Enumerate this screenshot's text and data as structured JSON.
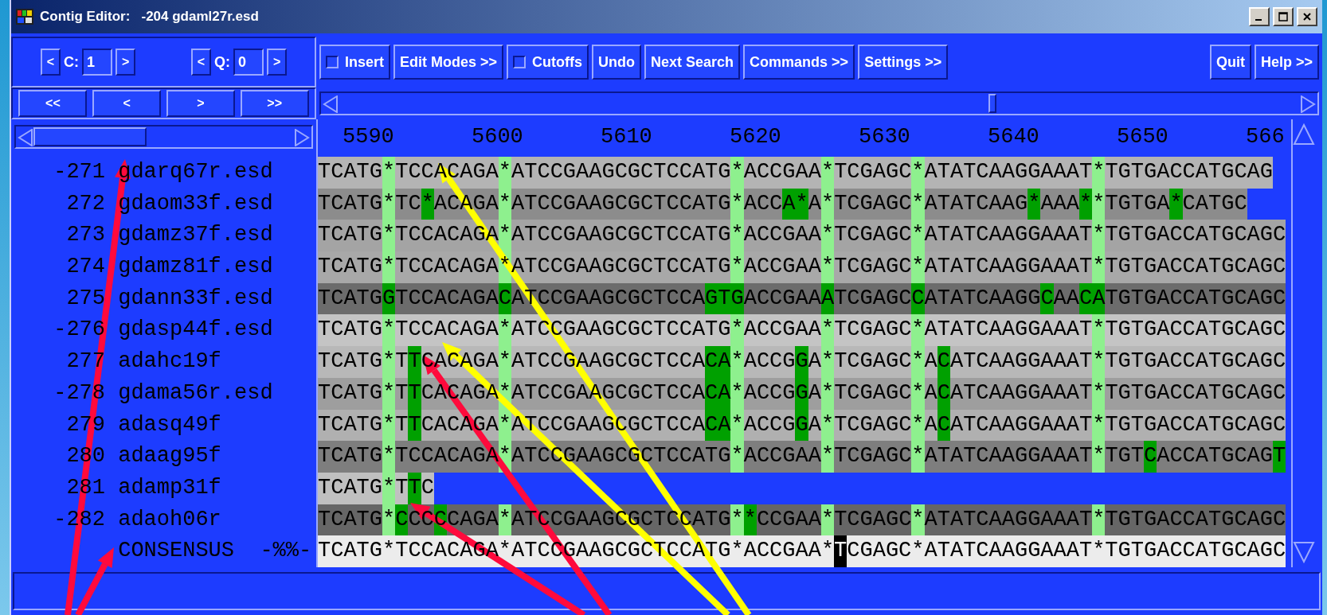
{
  "window": {
    "title": "Contig Editor:   -204 gdaml27r.esd"
  },
  "contig_controls": [
    {
      "label": "C:",
      "value": "1",
      "prev": "<",
      "next": ">"
    },
    {
      "label": "Q:",
      "value": "0",
      "prev": "<",
      "next": ">"
    }
  ],
  "toolbar": [
    {
      "kind": "checkbox",
      "label": "Insert",
      "checked": false
    },
    {
      "kind": "button",
      "label": "Edit Modes >>"
    },
    {
      "kind": "checkbox",
      "label": "Cutoffs",
      "checked": false
    },
    {
      "kind": "button",
      "label": "Undo"
    },
    {
      "kind": "button",
      "label": "Next Search"
    },
    {
      "kind": "button",
      "label": "Commands >>"
    },
    {
      "kind": "button",
      "label": "Settings >>"
    }
  ],
  "toolbar_right": [
    {
      "label": "Quit"
    },
    {
      "label": "Help >>"
    }
  ],
  "nav_buttons": [
    "<<",
    "<",
    ">",
    ">>"
  ],
  "ruler": [
    "5590",
    "5600",
    "5610",
    "5620",
    "5630",
    "5640",
    "5650",
    "566"
  ],
  "readings": [
    {
      "number": "-271",
      "name": "gdarq67r.esd",
      "color": "#b4b4b4",
      "segments": [
        {
          "kind": "base",
          "text": "TCATG"
        },
        {
          "kind": "pad",
          "text": "*"
        },
        {
          "kind": "base",
          "text": "TCCACAGA"
        },
        {
          "kind": "pad",
          "text": "*"
        },
        {
          "kind": "base",
          "text": "ATCCGAAGCGCTCCATG"
        },
        {
          "kind": "pad",
          "text": "*"
        },
        {
          "kind": "base",
          "text": "ACCGAA"
        },
        {
          "kind": "pad",
          "text": "*"
        },
        {
          "kind": "base",
          "text": "TCGAGC"
        },
        {
          "kind": "pad",
          "text": "*"
        },
        {
          "kind": "base",
          "text": "ATATCAAGGAAAT"
        },
        {
          "kind": "pad",
          "text": "*"
        },
        {
          "kind": "base",
          "text": "TGTGACCATGCAG"
        }
      ]
    },
    {
      "number": "272",
      "name": "gdaom33f.esd",
      "color": "#8c8c8c",
      "segments": [
        {
          "kind": "base",
          "text": "TCATG"
        },
        {
          "kind": "pad",
          "text": "*"
        },
        {
          "kind": "base",
          "text": "TC"
        },
        {
          "kind": "diff",
          "text": "*"
        },
        {
          "kind": "base",
          "text": "ACAGA"
        },
        {
          "kind": "pad",
          "text": "*"
        },
        {
          "kind": "base",
          "text": "ATCCGAAGCGCTCCATG"
        },
        {
          "kind": "pad",
          "text": "*"
        },
        {
          "kind": "base",
          "text": "ACC"
        },
        {
          "kind": "diff",
          "text": "A*"
        },
        {
          "kind": "base",
          "text": "A"
        },
        {
          "kind": "pad",
          "text": "*"
        },
        {
          "kind": "base",
          "text": "TCGAGC"
        },
        {
          "kind": "pad",
          "text": "*"
        },
        {
          "kind": "base",
          "text": "ATATCAAG"
        },
        {
          "kind": "diff",
          "text": "*"
        },
        {
          "kind": "base",
          "text": "AAA"
        },
        {
          "kind": "diff",
          "text": "*"
        },
        {
          "kind": "pad",
          "text": "*"
        },
        {
          "kind": "base",
          "text": "TGTGA"
        },
        {
          "kind": "diff",
          "text": "*"
        },
        {
          "kind": "base",
          "text": "CATGC"
        }
      ]
    },
    {
      "number": "273",
      "name": "gdamz37f.esd",
      "color": "#a4a4a4",
      "segments": [
        {
          "kind": "base",
          "text": "TCATG"
        },
        {
          "kind": "pad",
          "text": "*"
        },
        {
          "kind": "base",
          "text": "TCCACAGA"
        },
        {
          "kind": "pad",
          "text": "*"
        },
        {
          "kind": "base",
          "text": "ATCCGAAGCGCTCCATG"
        },
        {
          "kind": "pad",
          "text": "*"
        },
        {
          "kind": "base",
          "text": "ACCGAA"
        },
        {
          "kind": "pad",
          "text": "*"
        },
        {
          "kind": "base",
          "text": "TCGAGC"
        },
        {
          "kind": "pad",
          "text": "*"
        },
        {
          "kind": "base",
          "text": "ATATCAAGGAAAT"
        },
        {
          "kind": "pad",
          "text": "*"
        },
        {
          "kind": "base",
          "text": "TGTGACCATGCAGC"
        }
      ]
    },
    {
      "number": "274",
      "name": "gdamz81f.esd",
      "color": "#a8a8a8",
      "segments": [
        {
          "kind": "base",
          "text": "TCATG"
        },
        {
          "kind": "pad",
          "text": "*"
        },
        {
          "kind": "base",
          "text": "TCCACAGA"
        },
        {
          "kind": "pad",
          "text": "*"
        },
        {
          "kind": "base",
          "text": "ATCCGAAGCGCTCCATG"
        },
        {
          "kind": "pad",
          "text": "*"
        },
        {
          "kind": "base",
          "text": "ACCGAA"
        },
        {
          "kind": "pad",
          "text": "*"
        },
        {
          "kind": "base",
          "text": "TCGAGC"
        },
        {
          "kind": "pad",
          "text": "*"
        },
        {
          "kind": "base",
          "text": "ATATCAAGGAAAT"
        },
        {
          "kind": "pad",
          "text": "*"
        },
        {
          "kind": "base",
          "text": "TGTGACCATGCAGC"
        }
      ]
    },
    {
      "number": "275",
      "name": "gdann33f.esd",
      "color": "#6c6c6c",
      "segments": [
        {
          "kind": "base",
          "text": "TCATG"
        },
        {
          "kind": "diff",
          "text": "G"
        },
        {
          "kind": "base",
          "text": "TCCACAGA"
        },
        {
          "kind": "diff",
          "text": "C"
        },
        {
          "kind": "base",
          "text": "ATCCGAAGCGCTCCA"
        },
        {
          "kind": "diff",
          "text": "GTG"
        },
        {
          "kind": "base",
          "text": "ACCGAA"
        },
        {
          "kind": "diff",
          "text": "A"
        },
        {
          "kind": "base",
          "text": "TCGAGC"
        },
        {
          "kind": "diff",
          "text": "C"
        },
        {
          "kind": "base",
          "text": "ATATCAAGG"
        },
        {
          "kind": "diff",
          "text": "C"
        },
        {
          "kind": "base",
          "text": "AA"
        },
        {
          "kind": "diff",
          "text": "CA"
        },
        {
          "kind": "base",
          "text": "TGTGACCATGCAGC"
        }
      ]
    },
    {
      "number": "-276",
      "name": "gdasp44f.esd",
      "color": "#c4c4c4",
      "segments": [
        {
          "kind": "base",
          "text": "TCATG"
        },
        {
          "kind": "pad",
          "text": "*"
        },
        {
          "kind": "base",
          "text": "TCCACAGA"
        },
        {
          "kind": "pad",
          "text": "*"
        },
        {
          "kind": "base",
          "text": "ATCCGAAGCGCTCCATG"
        },
        {
          "kind": "pad",
          "text": "*"
        },
        {
          "kind": "base",
          "text": "ACCGAA"
        },
        {
          "kind": "pad",
          "text": "*"
        },
        {
          "kind": "base",
          "text": "TCGAGC"
        },
        {
          "kind": "pad",
          "text": "*"
        },
        {
          "kind": "base",
          "text": "ATATCAAGGAAAT"
        },
        {
          "kind": "pad",
          "text": "*"
        },
        {
          "kind": "base",
          "text": "TGTGACCATGCAGC"
        }
      ]
    },
    {
      "number": "277",
      "name": "adahc19f",
      "color": "#b8b8b8",
      "segments": [
        {
          "kind": "base",
          "text": "TCATG"
        },
        {
          "kind": "pad",
          "text": "*"
        },
        {
          "kind": "base",
          "text": "T"
        },
        {
          "kind": "diff",
          "text": "T"
        },
        {
          "kind": "base",
          "text": "CACAGA"
        },
        {
          "kind": "pad",
          "text": "*"
        },
        {
          "kind": "base",
          "text": "ATCCGAAGCGCTCCA"
        },
        {
          "kind": "diff",
          "text": "CA"
        },
        {
          "kind": "pad",
          "text": "*"
        },
        {
          "kind": "base",
          "text": "ACCG"
        },
        {
          "kind": "diff",
          "text": "G"
        },
        {
          "kind": "base",
          "text": "A"
        },
        {
          "kind": "pad",
          "text": "*"
        },
        {
          "kind": "base",
          "text": "TCGAGC"
        },
        {
          "kind": "pad",
          "text": "*"
        },
        {
          "kind": "base",
          "text": "A"
        },
        {
          "kind": "diff",
          "text": "C"
        },
        {
          "kind": "base",
          "text": "ATCAAGGAAAT"
        },
        {
          "kind": "pad",
          "text": "*"
        },
        {
          "kind": "base",
          "text": "TGTGACCATGCAGC"
        }
      ]
    },
    {
      "number": "-278",
      "name": "gdama56r.esd",
      "color": "#9e9e9e",
      "segments": [
        {
          "kind": "base",
          "text": "TCATG"
        },
        {
          "kind": "pad",
          "text": "*"
        },
        {
          "kind": "base",
          "text": "T"
        },
        {
          "kind": "diff",
          "text": "T"
        },
        {
          "kind": "base",
          "text": "CACAGA"
        },
        {
          "kind": "pad",
          "text": "*"
        },
        {
          "kind": "base",
          "text": "ATCCGAAGCGCTCCA"
        },
        {
          "kind": "diff",
          "text": "CA"
        },
        {
          "kind": "pad",
          "text": "*"
        },
        {
          "kind": "base",
          "text": "ACCG"
        },
        {
          "kind": "diff",
          "text": "G"
        },
        {
          "kind": "base",
          "text": "A"
        },
        {
          "kind": "pad",
          "text": "*"
        },
        {
          "kind": "base",
          "text": "TCGAGC"
        },
        {
          "kind": "pad",
          "text": "*"
        },
        {
          "kind": "base",
          "text": "A"
        },
        {
          "kind": "diff",
          "text": "C"
        },
        {
          "kind": "base",
          "text": "ATCAAGGAAAT"
        },
        {
          "kind": "pad",
          "text": "*"
        },
        {
          "kind": "base",
          "text": "TGTGACCATGCAGC"
        }
      ]
    },
    {
      "number": "279",
      "name": "adasq49f",
      "color": "#b0b0b0",
      "segments": [
        {
          "kind": "base",
          "text": "TCATG"
        },
        {
          "kind": "pad",
          "text": "*"
        },
        {
          "kind": "base",
          "text": "T"
        },
        {
          "kind": "diff",
          "text": "T"
        },
        {
          "kind": "base",
          "text": "CACAGA"
        },
        {
          "kind": "pad",
          "text": "*"
        },
        {
          "kind": "base",
          "text": "ATCCGAAGCGCTCCA"
        },
        {
          "kind": "diff",
          "text": "CA"
        },
        {
          "kind": "pad",
          "text": "*"
        },
        {
          "kind": "base",
          "text": "ACCG"
        },
        {
          "kind": "diff",
          "text": "G"
        },
        {
          "kind": "base",
          "text": "A"
        },
        {
          "kind": "pad",
          "text": "*"
        },
        {
          "kind": "base",
          "text": "TCGAGC"
        },
        {
          "kind": "pad",
          "text": "*"
        },
        {
          "kind": "base",
          "text": "A"
        },
        {
          "kind": "diff",
          "text": "C"
        },
        {
          "kind": "base",
          "text": "ATCAAGGAAAT"
        },
        {
          "kind": "pad",
          "text": "*"
        },
        {
          "kind": "base",
          "text": "TGTGACCATGCAGC"
        }
      ]
    },
    {
      "number": "280",
      "name": "adaag95f",
      "color": "#7e7e7e",
      "segments": [
        {
          "kind": "base",
          "text": "TCATG"
        },
        {
          "kind": "pad",
          "text": "*"
        },
        {
          "kind": "base",
          "text": "TCCACAGA"
        },
        {
          "kind": "pad",
          "text": "*"
        },
        {
          "kind": "base",
          "text": "ATCCGAAGCGCTCCATG"
        },
        {
          "kind": "pad",
          "text": "*"
        },
        {
          "kind": "base",
          "text": "ACCGAA"
        },
        {
          "kind": "pad",
          "text": "*"
        },
        {
          "kind": "base",
          "text": "TCGAGC"
        },
        {
          "kind": "pad",
          "text": "*"
        },
        {
          "kind": "base",
          "text": "ATATCAAGGAAAT"
        },
        {
          "kind": "pad",
          "text": "*"
        },
        {
          "kind": "base",
          "text": "TGT"
        },
        {
          "kind": "diff",
          "text": "C"
        },
        {
          "kind": "base",
          "text": "ACCATGCAG"
        },
        {
          "kind": "diff",
          "text": "T"
        }
      ]
    },
    {
      "number": "281",
      "name": "adamp31f",
      "color": "#c0c0c0",
      "segments": [
        {
          "kind": "base",
          "text": "TCATG"
        },
        {
          "kind": "pad",
          "text": "*"
        },
        {
          "kind": "base",
          "text": "T"
        },
        {
          "kind": "diff",
          "text": "T"
        },
        {
          "kind": "base",
          "text": "C"
        }
      ]
    },
    {
      "number": "-282",
      "name": "adaoh06r",
      "color": "#666666",
      "segments": [
        {
          "kind": "base",
          "text": "TCATG"
        },
        {
          "kind": "pad",
          "text": "*"
        },
        {
          "kind": "diff",
          "text": "C"
        },
        {
          "kind": "base",
          "text": "CC"
        },
        {
          "kind": "diff",
          "text": "C"
        },
        {
          "kind": "base",
          "text": "CAGA"
        },
        {
          "kind": "pad",
          "text": "*"
        },
        {
          "kind": "base",
          "text": "ATCCGAAGCGCTCCATG"
        },
        {
          "kind": "pad",
          "text": "*"
        },
        {
          "kind": "diff",
          "text": "*"
        },
        {
          "kind": "base",
          "text": "CCGAA"
        },
        {
          "kind": "pad",
          "text": "*"
        },
        {
          "kind": "base",
          "text": "TCGAGC"
        },
        {
          "kind": "pad",
          "text": "*"
        },
        {
          "kind": "base",
          "text": "ATATCAAGGAAAT"
        },
        {
          "kind": "pad",
          "text": "*"
        },
        {
          "kind": "base",
          "text": "TGTGACCATGCAGC"
        }
      ]
    }
  ],
  "consensus": {
    "name": "CONSENSUS",
    "marker": "-%%-",
    "color": "#ececec",
    "segments": [
      {
        "kind": "base",
        "text": "TCATG*TCCACAGA*ATCCGAAGCGCTCCATG*ACCGAA*"
      },
      {
        "kind": "cursor",
        "text": "T"
      },
      {
        "kind": "base",
        "text": "CGAGC*ATATCAAGGAAAT*TGTGACCATGCAGC"
      }
    ]
  },
  "annotation_arrows": [
    {
      "color": "#ff0a3c"
    },
    {
      "color": "#ff0a3c"
    },
    {
      "color": "#ff0a3c"
    },
    {
      "color": "#ff0a3c"
    },
    {
      "color": "#ffff00"
    },
    {
      "color": "#ffff00"
    }
  ]
}
